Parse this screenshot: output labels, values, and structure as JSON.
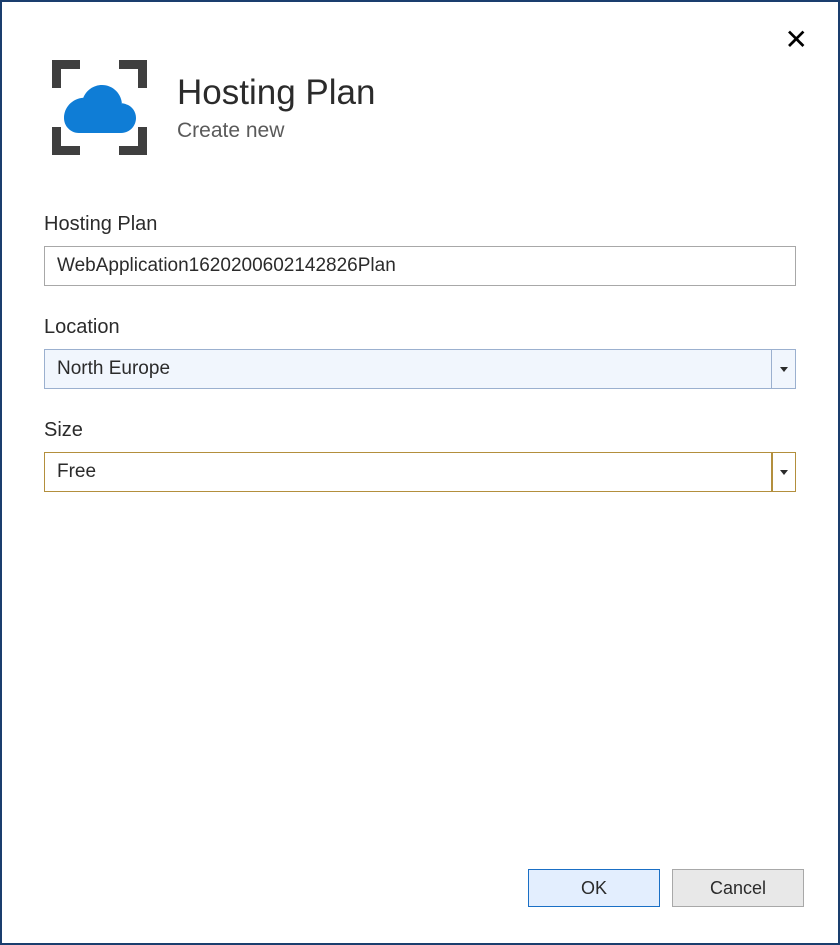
{
  "dialog": {
    "title": "Hosting Plan",
    "subtitle": "Create new"
  },
  "fields": {
    "hostingPlan": {
      "label": "Hosting Plan",
      "value": "WebApplication1620200602142826Plan"
    },
    "location": {
      "label": "Location",
      "value": "North Europe"
    },
    "size": {
      "label": "Size",
      "value": "Free"
    }
  },
  "buttons": {
    "ok": "OK",
    "cancel": "Cancel"
  },
  "icons": {
    "close": "✕"
  },
  "colors": {
    "dialogBorder": "#1a3e6e",
    "cloud": "#0f7dd6",
    "accentWarn": "#b38f3d",
    "accentPrimary": "#1a6fc5"
  }
}
